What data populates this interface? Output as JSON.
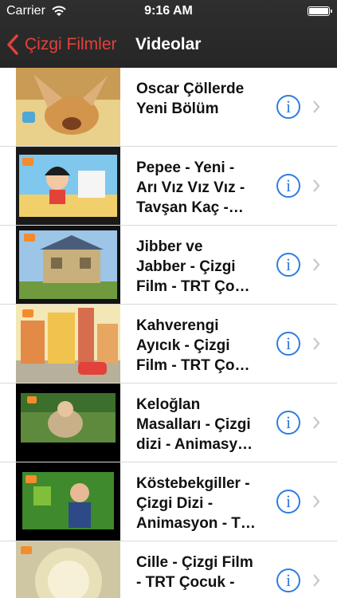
{
  "status_bar": {
    "carrier": "Carrier",
    "time": "9:16 AM"
  },
  "nav": {
    "back_label": "Çizgi Filmler",
    "title": "Videolar"
  },
  "colors": {
    "accent": "#e2423a",
    "info": "#2f7de1",
    "bar": "#2a2a2a"
  },
  "videos": [
    {
      "title": "Oscar Çöllerde\nYeni Bölüm"
    },
    {
      "title": "Pepee - Yeni -\nArı Vız Vız Vız -\nTavşan Kaç -…"
    },
    {
      "title": "Jibber ve\nJabber - Çizgi\nFilm - TRT Ço…"
    },
    {
      "title": "Kahverengi\nAyıcık - Çizgi\nFilm - TRT Ço…"
    },
    {
      "title": "Keloğlan\nMasalları - Çizgi\ndizi - Animasy…"
    },
    {
      "title": "Köstebekgiller -\nÇizgi Dizi -\nAnimasyon - T…"
    },
    {
      "title": "Cille - Çizgi Film\n- TRT Çocuk -"
    }
  ]
}
